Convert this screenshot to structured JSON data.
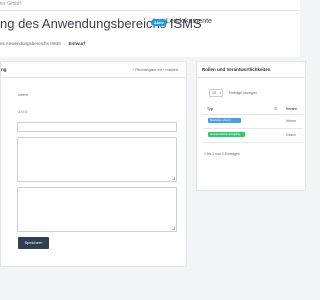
{
  "header": {
    "company": "ter GmbH",
    "title": "ng des Anwendungsbereichs ISMS",
    "badge": "Aktiv",
    "doc_type": "Leitdokumente",
    "breadcrumb": {
      "parent": "es Anwendungsbereichs ISMS",
      "current": "Entwurf"
    }
  },
  "form_card": {
    "title": "ng",
    "required_note": "Pflichtangabe mit * markiert",
    "values": [
      "Intern",
      "1.0.0"
    ],
    "save_label": "Speichern"
  },
  "roles_card": {
    "title": "Rollen und Verantwortlichkeiten",
    "page_size": "10",
    "entries_label": "Einträge anzeigen",
    "columns": [
      "Typ",
      "Verant"
    ],
    "rows": [
      {
        "type": "Bearbeiten (Autor)",
        "value": "Inform",
        "color": "#4a9fe6"
      },
      {
        "type": "Verantwortlicher (Freigabe)",
        "value": "Gesch",
        "color": "#2ecc71"
      }
    ],
    "pagination_info": "1 bis 2 von 2 Einträgen"
  },
  "colors": {
    "accent_blue": "#1d9be6",
    "save_button": "#2f3f52"
  }
}
